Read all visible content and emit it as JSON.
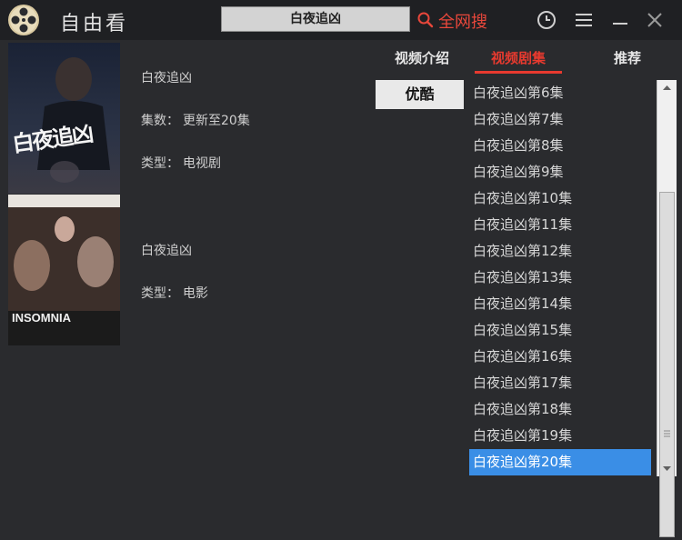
{
  "app": {
    "name": "自由看"
  },
  "search": {
    "query": "白夜追凶",
    "search_all_label": "全网搜"
  },
  "results": [
    {
      "title": "白夜追凶",
      "episodes_label": "集数：",
      "episodes_value": "更新至20集",
      "type_label": "类型：",
      "type_value": "电视剧",
      "poster_text": "白夜追凶"
    },
    {
      "title": "白夜追凶",
      "type_label": "类型：",
      "type_value": "电影",
      "poster_text": "INSOMNIA"
    }
  ],
  "tabs": [
    {
      "label": "视频介绍"
    },
    {
      "label": "视频剧集"
    },
    {
      "label": "推荐"
    }
  ],
  "source": {
    "label": "优酷"
  },
  "episodes": [
    "白夜追凶第6集",
    "白夜追凶第7集",
    "白夜追凶第8集",
    "白夜追凶第9集",
    "白夜追凶第10集",
    "白夜追凶第11集",
    "白夜追凶第12集",
    "白夜追凶第13集",
    "白夜追凶第14集",
    "白夜追凶第15集",
    "白夜追凶第16集",
    "白夜追凶第17集",
    "白夜追凶第18集",
    "白夜追凶第19集",
    "白夜追凶第20集"
  ],
  "colors": {
    "accent": "#e83a2f",
    "selected": "#3a8ee6",
    "background": "#2a2b2e"
  }
}
